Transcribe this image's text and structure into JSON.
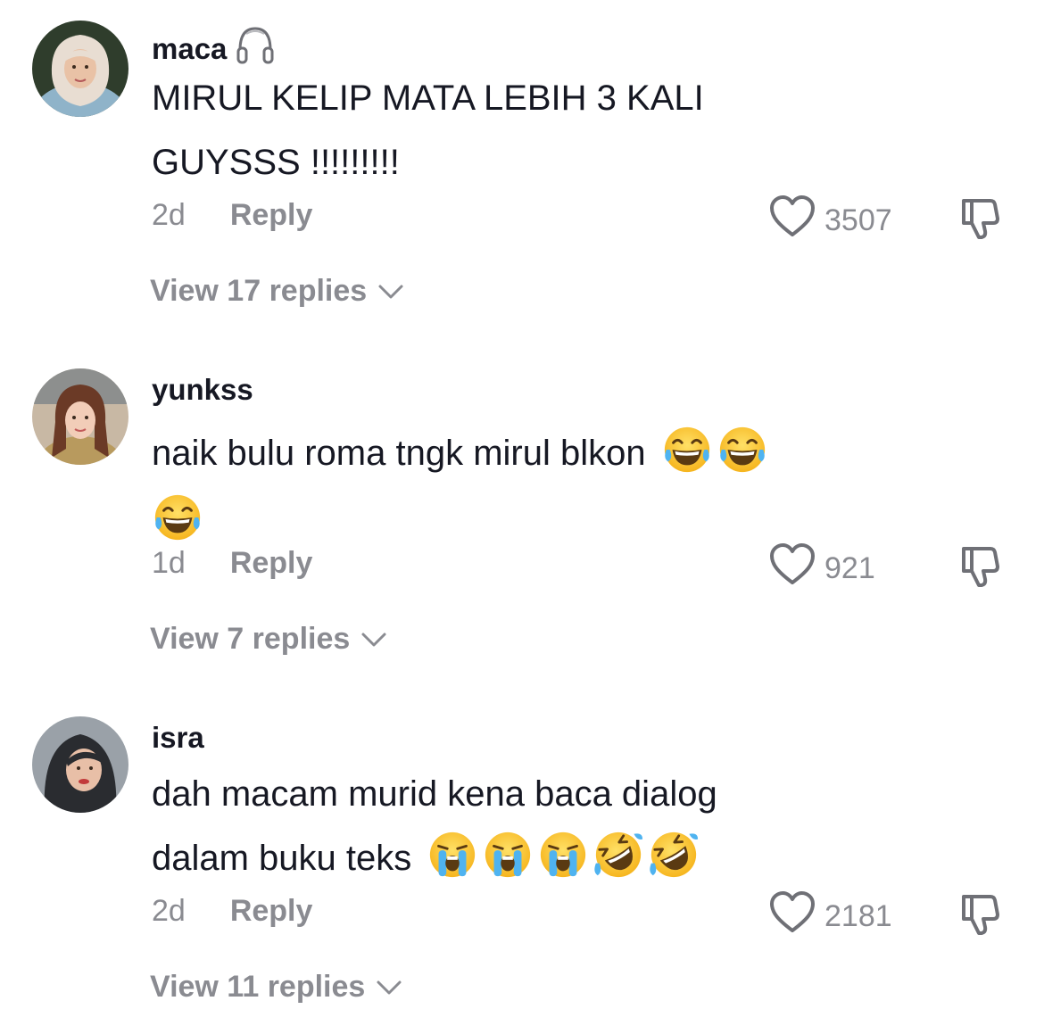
{
  "comments": [
    {
      "username": "maca",
      "badge_icon": "headphones-icon",
      "text": "MIRUL KELIP MATA LEBIH 3 KALI GUYSSS !!!!!!!!!",
      "text_line1": "MIRUL KELIP MATA LEBIH 3 KALI",
      "text_line2": "GUYSSS !!!!!!!!!",
      "emojis": [],
      "age": "2d",
      "reply_label": "Reply",
      "likes": "3507",
      "view_replies": "View 17 replies",
      "avatar_colors": {
        "bg": "#2f3d2c",
        "scarf": "#e8ddd2",
        "face": "#e9c2a6",
        "shirt": "#8fb3c9"
      }
    },
    {
      "username": "yunkss",
      "text": "naik bulu roma tngk mirul blkon",
      "emojis": [
        "tears-of-joy",
        "tears-of-joy",
        "tears-of-joy"
      ],
      "age": "1d",
      "reply_label": "Reply",
      "likes": "921",
      "view_replies": "View 7 replies",
      "avatar_colors": {
        "bg": "#c8b8a4",
        "hair": "#6b3a26",
        "face": "#f2cdb8",
        "shirt": "#b89a5e"
      }
    },
    {
      "username": "isra",
      "text_line1": "dah macam murid kena baca dialog",
      "text_line2": "dalam buku teks",
      "emojis": [
        "loudly-crying",
        "loudly-crying",
        "loudly-crying",
        "rolling-laughing",
        "rolling-laughing"
      ],
      "age": "2d",
      "reply_label": "Reply",
      "likes": "2181",
      "view_replies": "View 11 replies",
      "avatar_colors": {
        "bg": "#9aa1a8",
        "scarf": "#2a2c30",
        "face": "#e8bfa7",
        "lips": "#c23a3a"
      }
    }
  ],
  "icons": {
    "like": "heart-outline-icon",
    "dislike": "thumbs-down-outline-icon",
    "expand": "chevron-down-icon"
  },
  "colors": {
    "text_primary": "#161823",
    "text_secondary": "#8a8b91",
    "background": "#ffffff"
  }
}
